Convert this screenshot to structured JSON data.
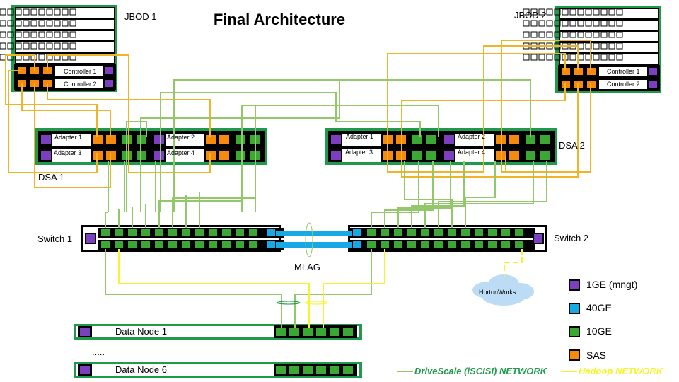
{
  "title": "Final Architecture",
  "jbods": [
    {
      "label": "JBOD 1",
      "controllers": [
        "Controller 1",
        "Controller 2"
      ]
    },
    {
      "label": "JBOD 2",
      "controllers": [
        "Controller 1",
        "Controller 2"
      ]
    }
  ],
  "dsas": [
    {
      "label": "DSA 1",
      "adapters": [
        "Adapter 1",
        "Adapter 2",
        "Adapter 3",
        "Adapter 4"
      ]
    },
    {
      "label": "DSA 2",
      "adapters": [
        "Adapter 1",
        "Adapter 2",
        "Adapter 3",
        "Adapter 4"
      ]
    }
  ],
  "switches": [
    {
      "label": "Switch 1"
    },
    {
      "label": "Switch 2"
    }
  ],
  "mlag_label": "MLAG",
  "cloud_label": "HortonWorks",
  "data_nodes": [
    {
      "label": "Data Node 1"
    },
    {
      "label": "Data Node 6"
    }
  ],
  "ellipsis": ".....",
  "legend": [
    {
      "label": "1GE (mngt)",
      "color": "#7b3fbf"
    },
    {
      "label": "40GE",
      "color": "#17a9e6"
    },
    {
      "label": "10GE",
      "color": "#3aa832"
    },
    {
      "label": "SAS",
      "color": "#f7890c"
    }
  ],
  "networks": [
    {
      "label": "DriveScale (iSCISI) NETWORK",
      "color": "#1e9a4a"
    },
    {
      "label": "Hadoop NETWORK",
      "color": "#f5f52a"
    }
  ],
  "colors": {
    "frame": "#1e9a4a",
    "sas_wire": "#f0b429",
    "iscsi_wire": "#92c86a",
    "hadoop_wire": "#f5f52a"
  }
}
